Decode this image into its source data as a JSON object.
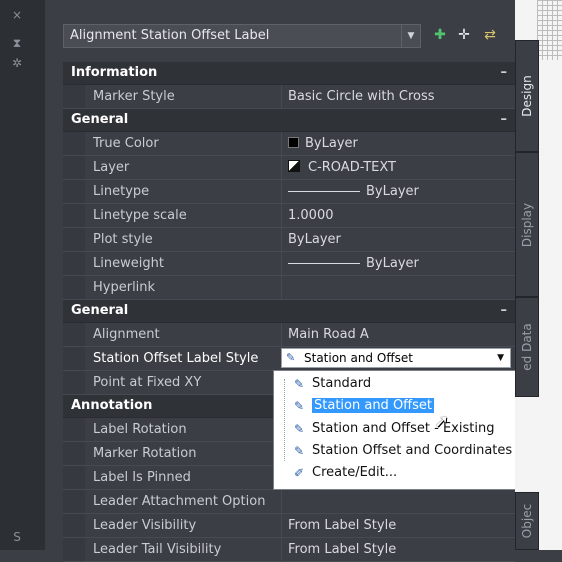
{
  "left_strip": {
    "close": "×",
    "pin": "⧗",
    "settings": "✲",
    "bottom": "S"
  },
  "title_combo": {
    "value": "Alignment Station Offset Label"
  },
  "toolbar": {
    "icon1": "add-selection-icon",
    "icon2": "pick-icon",
    "icon3": "quick-select-icon"
  },
  "sections": {
    "information": {
      "title": "Information",
      "rows": [
        {
          "label": "Marker Style",
          "value": "Basic Circle with Cross"
        }
      ]
    },
    "general1": {
      "title": "General",
      "rows": [
        {
          "label": "True Color",
          "value": "ByLayer"
        },
        {
          "label": "Layer",
          "value": "C-ROAD-TEXT"
        },
        {
          "label": "Linetype",
          "value": "ByLayer"
        },
        {
          "label": "Linetype scale",
          "value": "1.0000"
        },
        {
          "label": "Plot style",
          "value": "ByLayer"
        },
        {
          "label": "Lineweight",
          "value": "ByLayer"
        },
        {
          "label": "Hyperlink",
          "value": ""
        }
      ]
    },
    "general2": {
      "title": "General",
      "rows": [
        {
          "label": "Alignment",
          "value": "Main Road A"
        },
        {
          "label": "Station Offset Label Style",
          "value": "Station and Offset"
        },
        {
          "label": "Point at Fixed XY",
          "value": ""
        }
      ]
    },
    "annotation": {
      "title": "Annotation",
      "rows": [
        {
          "label": "Label Rotation",
          "value": ""
        },
        {
          "label": "Marker Rotation",
          "value": ""
        },
        {
          "label": "Label Is Pinned",
          "value": ""
        },
        {
          "label": "Leader Attachment Option",
          "value": ""
        },
        {
          "label": "Leader Visibility",
          "value": "From Label Style"
        },
        {
          "label": "Leader Tail Visibility",
          "value": "From Label Style"
        }
      ]
    }
  },
  "dropdown": {
    "items": [
      "Standard",
      "Station and Offset",
      "Station and Offset - Existing",
      "Station Offset and Coordinates",
      "Create/Edit..."
    ]
  },
  "tabs": {
    "design": "Design",
    "display": "Display",
    "extended": "ed Data",
    "objects": "Objec"
  },
  "colors": {
    "panel": "#3b3e44",
    "highlight": "#3399ff"
  }
}
